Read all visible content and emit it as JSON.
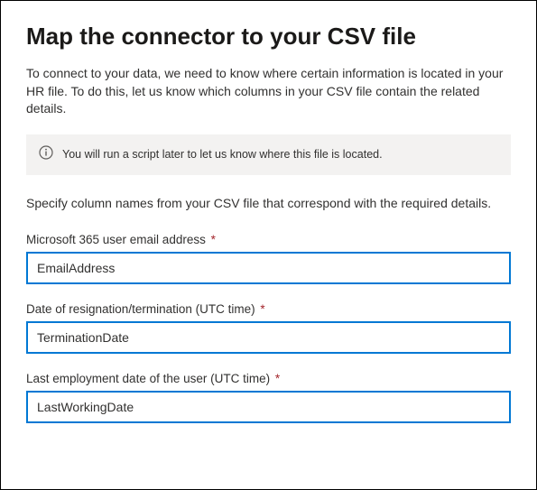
{
  "title": "Map the connector to your CSV file",
  "intro": "To connect to your data, we need to know where certain information is located in your HR file. To do this, let us know which columns in your CSV file contain the related details.",
  "info_text": "You will run a script later to let us know where this file is located.",
  "subhead": "Specify column names from your CSV file that correspond with the required details.",
  "fields": {
    "email": {
      "label": "Microsoft 365 user email address",
      "value": "EmailAddress"
    },
    "termination": {
      "label": "Date of resignation/termination (UTC time)",
      "value": "TerminationDate"
    },
    "lastworking": {
      "label": "Last employment date of the user (UTC time)",
      "value": "LastWorkingDate"
    }
  },
  "required_marker": "*"
}
